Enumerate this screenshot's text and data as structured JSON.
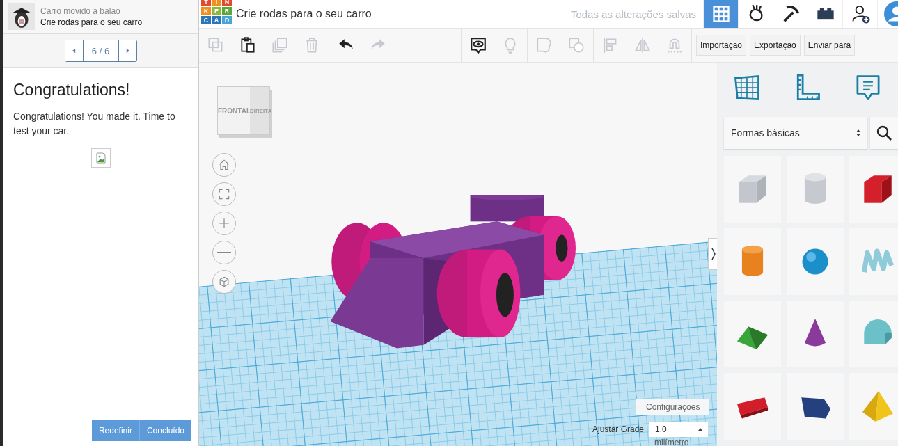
{
  "lesson": {
    "course": "Carro movido a balão",
    "title": "Crie rodas para o seu carro",
    "pager": "6 / 6",
    "heading": "Congratulations!",
    "body": "Congratulations! You made it. Time to test your car.",
    "buttons": [
      {
        "label": "Redefinir"
      },
      {
        "label": "Concluído"
      }
    ]
  },
  "logo": {
    "letters": [
      {
        "char": "T",
        "color": "#e2492f"
      },
      {
        "char": "I",
        "color": "#f0901e"
      },
      {
        "char": "N",
        "color": "#e2492f"
      },
      {
        "char": "K",
        "color": "#f0901e"
      },
      {
        "char": "E",
        "color": "#8ab93b"
      },
      {
        "char": "R",
        "color": "#58a936"
      },
      {
        "char": "C",
        "color": "#2b77b8"
      },
      {
        "char": "A",
        "color": "#2b77b8"
      },
      {
        "char": "D",
        "color": "#4ba4d8"
      }
    ]
  },
  "app": {
    "title": "Crie rodas para o seu carro",
    "save_status": "Todas as alterações salvas",
    "nav": [
      {
        "kind": "grid",
        "selected": true
      },
      {
        "kind": "hand",
        "selected": false
      },
      {
        "kind": "pickaxe",
        "selected": false
      },
      {
        "kind": "brick",
        "selected": false
      },
      {
        "kind": "user-add",
        "selected": false
      },
      {
        "kind": "avatar",
        "selected": false
      }
    ]
  },
  "toolbar": {
    "groups": [
      [
        {
          "kind": "copy",
          "disabled": true
        },
        {
          "kind": "paste",
          "disabled": false
        },
        {
          "kind": "duplicate",
          "disabled": true
        },
        {
          "kind": "delete",
          "disabled": true
        }
      ],
      [
        {
          "kind": "undo",
          "disabled": false
        },
        {
          "kind": "redo",
          "disabled": true
        }
      ],
      [
        {
          "kind": "notes",
          "disabled": false
        },
        {
          "kind": "bulb",
          "disabled": true
        }
      ],
      [
        {
          "kind": "group",
          "disabled": true
        },
        {
          "kind": "ungroup",
          "disabled": true
        }
      ],
      [
        {
          "kind": "align",
          "disabled": true
        },
        {
          "kind": "mirror",
          "disabled": true
        },
        {
          "kind": "magnet",
          "disabled": true
        }
      ]
    ],
    "buttons": [
      {
        "label": "Importação"
      },
      {
        "label": "Exportação"
      },
      {
        "label": "Enviar para"
      }
    ]
  },
  "viewcube": {
    "front": "FRONTAL",
    "right": "DIREITA"
  },
  "view_controls": [
    {
      "kind": "home"
    },
    {
      "kind": "fit"
    },
    {
      "kind": "zoom-in"
    },
    {
      "kind": "zoom-out"
    },
    {
      "kind": "ortho"
    }
  ],
  "grid_settings": {
    "button": "Configurações",
    "label": "Ajustar Grade",
    "value": "1,0",
    "unit": "milímetro"
  },
  "shapes_panel": {
    "tabs": [
      {
        "kind": "workplane"
      },
      {
        "kind": "ruler"
      },
      {
        "kind": "notes"
      }
    ],
    "category": "Formas básicas",
    "shapes": [
      {
        "kind": "box-hole"
      },
      {
        "kind": "cylinder-hole"
      },
      {
        "kind": "box",
        "color": "#d4202a"
      },
      {
        "kind": "cylinder",
        "color": "#e8821e"
      },
      {
        "kind": "sphere",
        "color": "#1a8fc9"
      },
      {
        "kind": "scribble",
        "color": "#8fcbd9"
      },
      {
        "kind": "roof",
        "color": "#3aa53a"
      },
      {
        "kind": "cone",
        "color": "#8a3a9a"
      },
      {
        "kind": "round-roof",
        "color": "#6cc0c8"
      },
      {
        "kind": "text",
        "color": "#d21e2a"
      },
      {
        "kind": "polygon",
        "color": "#24407f"
      },
      {
        "kind": "pyramid",
        "color": "#f0c419"
      }
    ]
  }
}
